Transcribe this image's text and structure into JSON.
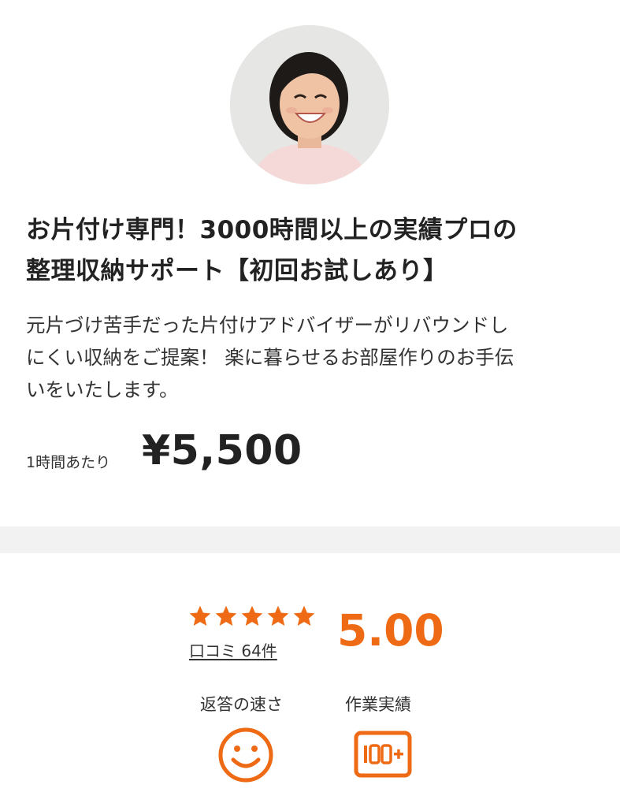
{
  "listing": {
    "title_line1": "お片付け専門！3000時間以上の実績プロの",
    "title_line2": "整理収納サポート【初回お試しあり】",
    "description_line1": "元片づけ苦手だった片付けアドバイザーがリバウンドし",
    "description_line2": "にくい収納をご提案！ 楽に暮らせるお部屋作りのお手伝",
    "description_line3": "いをいたします。",
    "price_unit": "1時間あたり",
    "price": "¥5,500"
  },
  "rating": {
    "stars": 5,
    "reviews_link": "口コミ 64件",
    "score": "5.00"
  },
  "metrics": {
    "speed_label": "返答の速さ",
    "speed_icon": "smiley-face-icon",
    "achievements_label": "作業実績",
    "achievements_icon": "100-plus-badge-icon"
  },
  "colors": {
    "accent": "#ee6a14",
    "text": "#222222",
    "divider": "#f2f2f2"
  }
}
